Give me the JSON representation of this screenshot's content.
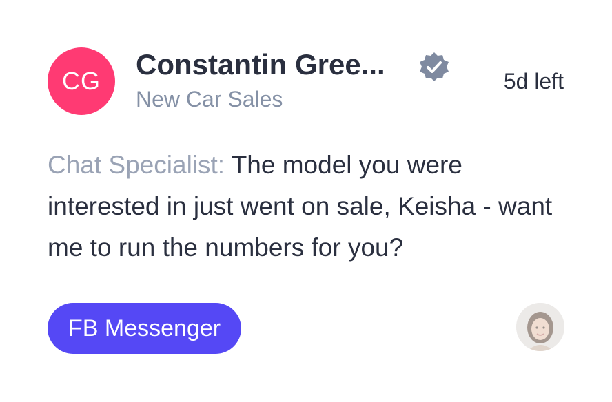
{
  "contact": {
    "initials": "CG",
    "avatar_color": "#ff3a73",
    "name": "Constantin Gree...",
    "verified_icon": "verified-badge-icon",
    "department": "New Car Sales"
  },
  "status": {
    "time_left": "5d left"
  },
  "message": {
    "sender_label": "Chat Specialist:",
    "text": "The model you were interested in just went on sale, Keisha - want me to run the numbers for you?"
  },
  "channel": {
    "label": "FB Messenger",
    "color": "#5548f5"
  },
  "agent": {
    "avatar_icon": "agent-avatar-photo"
  },
  "colors": {
    "text_primary": "#2a2f3f",
    "text_muted": "#8591a6",
    "badge_gray": "#7f8aa0"
  }
}
